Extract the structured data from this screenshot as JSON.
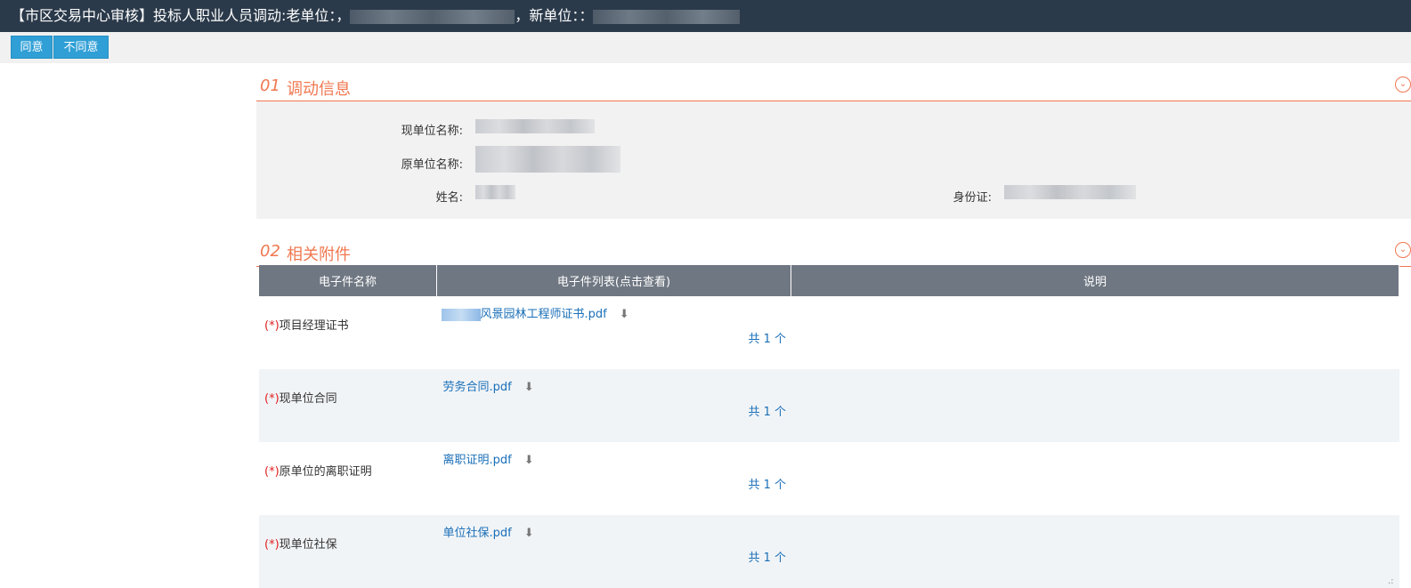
{
  "header": {
    "title_prefix": "【市区交易中心审核】投标人职业人员调动:老单位：",
    "title_mid": "，新单位：",
    "old_unit_hint": "，",
    "new_unit_hint": "："
  },
  "toolbar": {
    "agree_label": "同意",
    "disagree_label": "不同意"
  },
  "section1": {
    "num": "01",
    "title": "调动信息",
    "fields": {
      "current_unit_label": "现单位名称:",
      "original_unit_label": "原单位名称:",
      "name_label": "姓名:",
      "id_label": "身份证:"
    }
  },
  "section2": {
    "num": "02",
    "title": "相关附件",
    "columns": [
      "电子件名称",
      "电子件列表(点击查看)",
      "说明"
    ],
    "rows": [
      {
        "req": "(*)",
        "name": "项目经理证书",
        "file": "风景园林工程师证书.pdf",
        "count": "共 1 个",
        "note": ""
      },
      {
        "req": "(*)",
        "name": "现单位合同",
        "file": "劳务合同.pdf",
        "count": "共 1 个",
        "note": ""
      },
      {
        "req": "(*)",
        "name": "原单位的离职证明",
        "file": "离职证明.pdf",
        "count": "共 1 个",
        "note": ""
      },
      {
        "req": "(*)",
        "name": "现单位社保",
        "file": "单位社保.pdf",
        "count": "共 1 个",
        "note": ""
      }
    ]
  },
  "icons": {
    "toggle": "chevron-down-circle-icon",
    "download": "download-icon",
    "resize": "resize-grip-icon"
  },
  "colors": {
    "accent": "#f07850",
    "button": "#2f9fd6",
    "header_bg": "#2b3a4a",
    "link": "#1a6fb8"
  }
}
